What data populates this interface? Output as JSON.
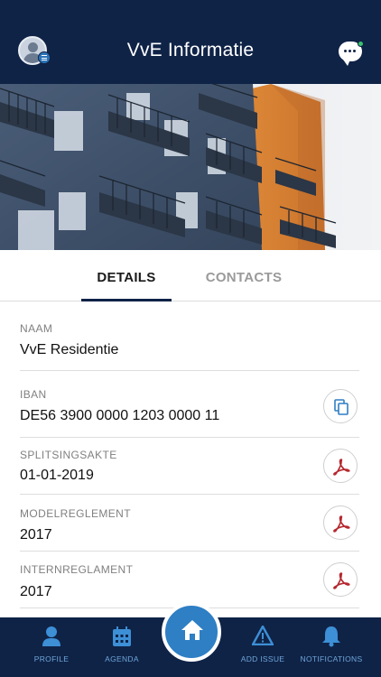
{
  "header": {
    "title": "VvE Informatie",
    "icons": {
      "left": "user-avatar-icon",
      "right": "chat-icon"
    }
  },
  "tabs": {
    "details": "DETAILS",
    "contacts": "CONTACTS",
    "active": "DETAILS"
  },
  "fields": [
    {
      "label": "NAAM",
      "value": "VvE Residentie",
      "action": null
    },
    {
      "label": "IBAN",
      "value": "DE56 3900 0000 1203 0000 11",
      "action": "copy-icon"
    },
    {
      "label": "SPLITSINGSAKTE",
      "value": "01-01-2019",
      "action": "pdf-icon"
    },
    {
      "label": "MODELREGLEMENT",
      "value": "2017",
      "action": "pdf-icon"
    },
    {
      "label": "INTERNREGLAMENT",
      "value": "2017",
      "action": "pdf-icon"
    }
  ],
  "bottom_nav": {
    "profile": "PROFILE",
    "agenda": "AGENDA",
    "home": "home-icon",
    "add_issue": "ADD ISSUE",
    "notifications": "NOTIFICATIONS"
  },
  "colors": {
    "header_bg": "#0f2347",
    "accent": "#2e7fc4",
    "pdf_red": "#b5282e",
    "nav_label": "#6fa6d8"
  }
}
